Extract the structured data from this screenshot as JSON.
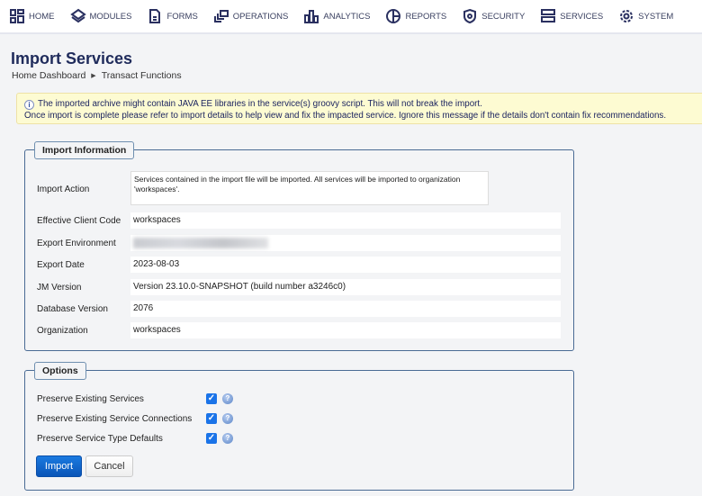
{
  "nav": {
    "items": [
      {
        "label": "HOME",
        "icon": "grid-icon"
      },
      {
        "label": "MODULES",
        "icon": "layers-icon"
      },
      {
        "label": "FORMS",
        "icon": "document-icon"
      },
      {
        "label": "OPERATIONS",
        "icon": "windows-icon"
      },
      {
        "label": "ANALYTICS",
        "icon": "bar-chart-icon"
      },
      {
        "label": "REPORTS",
        "icon": "pie-chart-icon"
      },
      {
        "label": "SECURITY",
        "icon": "shield-icon"
      },
      {
        "label": "SERVICES",
        "icon": "server-icon"
      },
      {
        "label": "SYSTEM",
        "icon": "gear-icon"
      }
    ]
  },
  "page": {
    "title": "Import Services",
    "breadcrumb": [
      "Home Dashboard",
      "Transact Functions"
    ]
  },
  "alert": {
    "line1": "The imported archive might contain JAVA EE libraries in the service(s) groovy script. This will not break the import.",
    "line2": "Once import is complete please refer to import details to help view and fix the impacted service. Ignore this message if the details don't contain fix recommendations."
  },
  "import_info": {
    "legend": "Import Information",
    "fields": [
      {
        "label": "Import Action",
        "value": "Services contained in the import file will be imported. All services will be imported to organization 'workspaces'."
      },
      {
        "label": "Effective Client Code",
        "value": "workspaces"
      },
      {
        "label": "Export Environment",
        "value": ""
      },
      {
        "label": "Export Date",
        "value": "2023-08-03"
      },
      {
        "label": "JM Version",
        "value": "Version 23.10.0-SNAPSHOT (build number a3246c0)"
      },
      {
        "label": "Database Version",
        "value": "2076"
      },
      {
        "label": "Organization",
        "value": "workspaces"
      }
    ]
  },
  "options": {
    "legend": "Options",
    "items": [
      {
        "label": "Preserve Existing Services",
        "checked": true
      },
      {
        "label": "Preserve Existing Service Connections",
        "checked": true
      },
      {
        "label": "Preserve Service Type Defaults",
        "checked": true
      }
    ]
  },
  "buttons": {
    "import": "Import",
    "cancel": "Cancel"
  },
  "colors": {
    "primary": "#1a73e8",
    "nav_text": "#3a4060",
    "title": "#1f2b5b",
    "alert_bg": "#fdfbd2"
  }
}
